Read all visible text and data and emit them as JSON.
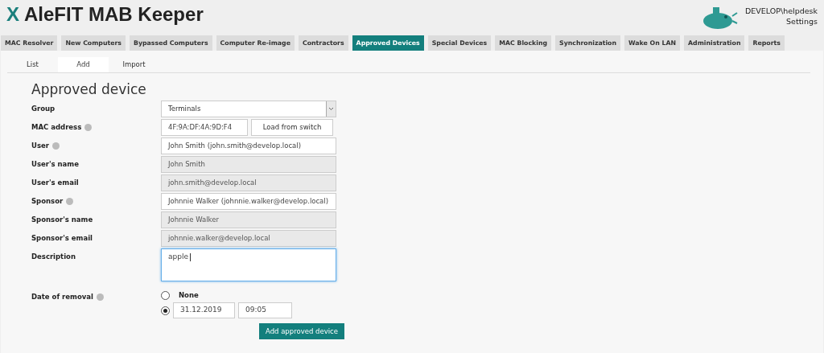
{
  "header": {
    "logo_mark": "X",
    "title": "AleFIT MAB Keeper",
    "user": "DEVELOP\\helpdesk",
    "settings": "Settings"
  },
  "tabs": [
    {
      "label": "MAC Resolver",
      "selected": false
    },
    {
      "label": "New Computers",
      "selected": false
    },
    {
      "label": "Bypassed Computers",
      "selected": false
    },
    {
      "label": "Computer Re-image",
      "selected": false
    },
    {
      "label": "Contractors",
      "selected": false
    },
    {
      "label": "Approved Devices",
      "selected": true
    },
    {
      "label": "Special Devices",
      "selected": false
    },
    {
      "label": "MAC Blocking",
      "selected": false
    },
    {
      "label": "Synchronization",
      "selected": false
    },
    {
      "label": "Wake On LAN",
      "selected": false
    },
    {
      "label": "Administration",
      "selected": false
    },
    {
      "label": "Reports",
      "selected": false
    }
  ],
  "subtabs": [
    {
      "label": "List",
      "selected": false
    },
    {
      "label": "Add",
      "selected": true
    },
    {
      "label": "Import",
      "selected": false
    }
  ],
  "form": {
    "title": "Approved device",
    "fields": [
      {
        "kind": "select",
        "label": "Group",
        "help": false,
        "value": "Terminals"
      },
      {
        "kind": "mac",
        "label": "MAC address",
        "help": true,
        "value": "4F:9A:DF:4A:9D:F4",
        "button": "Load from switch"
      },
      {
        "kind": "input",
        "label": "User",
        "help": true,
        "value": "John Smith (john.smith@develop.local)"
      },
      {
        "kind": "readonly",
        "label": "User's name",
        "help": false,
        "value": "John Smith"
      },
      {
        "kind": "readonly",
        "label": "User's email",
        "help": false,
        "value": "john.smith@develop.local"
      },
      {
        "kind": "input",
        "label": "Sponsor",
        "help": true,
        "value": "Johnnie Walker (johnnie.walker@develop.local)"
      },
      {
        "kind": "readonly",
        "label": "Sponsor's name",
        "help": false,
        "value": "Johnnie Walker"
      },
      {
        "kind": "readonly",
        "label": "Sponsor's email",
        "help": false,
        "value": "johnnie.walker@develop.local"
      },
      {
        "kind": "textarea",
        "label": "Description",
        "help": false,
        "value": "apple"
      }
    ],
    "removal": {
      "label": "Date of removal",
      "help": true,
      "options": [
        {
          "kind": "none",
          "label": "None",
          "selected": false
        },
        {
          "kind": "datetime",
          "date": "31.12.2019",
          "time": "09:05",
          "selected": true
        }
      ]
    },
    "submit": "Add approved device"
  }
}
